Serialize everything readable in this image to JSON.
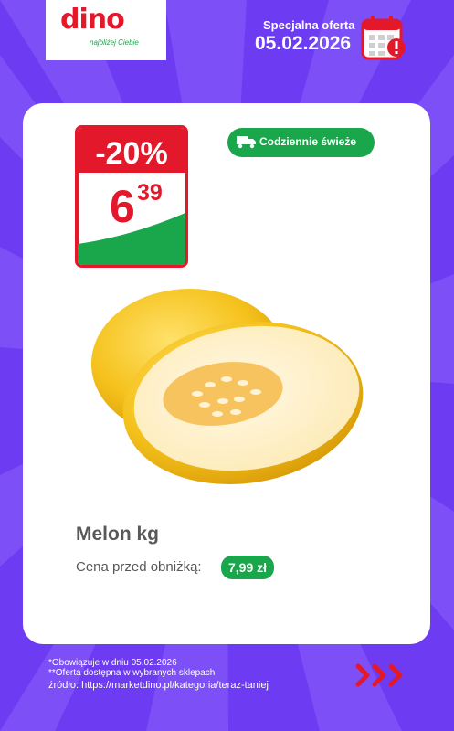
{
  "brand": {
    "logo_text": "dino",
    "tagline": "najbliżej Ciebie",
    "red": "#e3182b",
    "green": "#1aa64a",
    "purple": "#6d3cf2"
  },
  "offer": {
    "label": "Specjalna oferta",
    "date": "05.02.2026",
    "icon": "calendar-icon"
  },
  "product": {
    "discount": "-20%",
    "price_main": "6",
    "price_fraction": "39",
    "badge": "Codziennie świeże",
    "badge_icon": "truck-icon",
    "name": "Melon kg",
    "old_price_label": "Cena przed obniżką:",
    "old_price": "7,99 zł"
  },
  "footer": {
    "note1": "*Obowiązuje w dniu 05.02.2026",
    "note2": "**Oferta dostępna w wybranych sklepach",
    "source": "źródło: https://marketdino.pl/kategoria/teraz-taniej",
    "next_icon": "triple-chevron-right-icon"
  }
}
